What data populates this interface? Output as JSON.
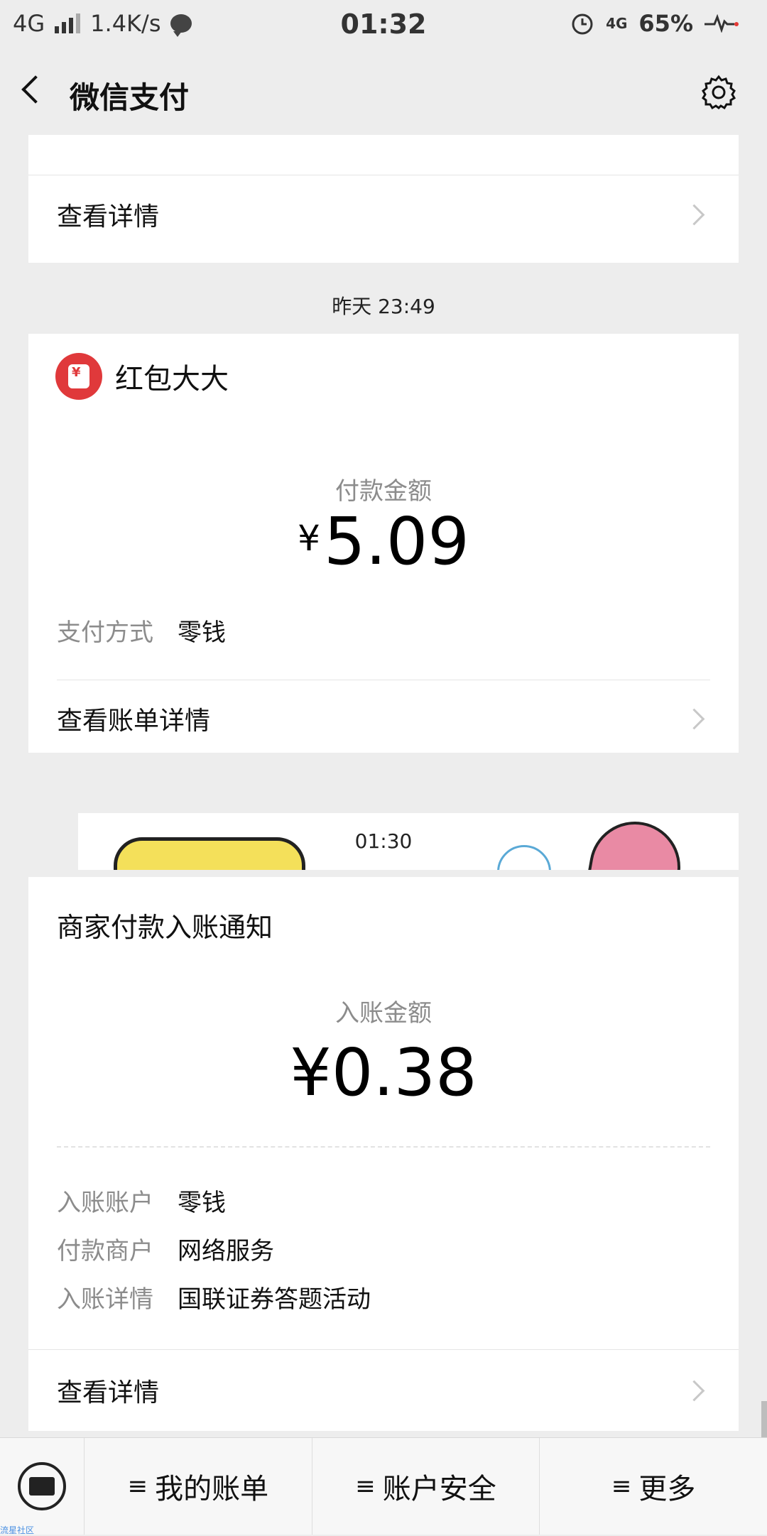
{
  "status_bar": {
    "network": "4G",
    "speed": "1.4K/s",
    "time": "01:32",
    "net2": "4G",
    "battery": "65%"
  },
  "header": {
    "title": "微信支付"
  },
  "top_card": {
    "link_label": "查看详情"
  },
  "msg1": {
    "timestamp": "昨天 23:49",
    "merchant": "红包大大",
    "amount_label": "付款金额",
    "currency": "¥",
    "amount": "5.09",
    "payment_method_key": "支付方式",
    "payment_method_value": "零钱",
    "link_label": "查看账单详情"
  },
  "msg2": {
    "timestamp": "01:30",
    "title": "商家付款入账通知",
    "amount_label": "入账金额",
    "amount": "¥0.38",
    "details": [
      {
        "key": "入账账户",
        "value": "零钱"
      },
      {
        "key": "付款商户",
        "value": "网络服务"
      },
      {
        "key": "入账详情",
        "value": "国联证券答题活动"
      }
    ],
    "link_label": "查看详情"
  },
  "bottom_bar": {
    "tabs": [
      {
        "label": "我的账单"
      },
      {
        "label": "账户安全"
      },
      {
        "label": "更多"
      }
    ]
  },
  "watermark": "流星社区"
}
